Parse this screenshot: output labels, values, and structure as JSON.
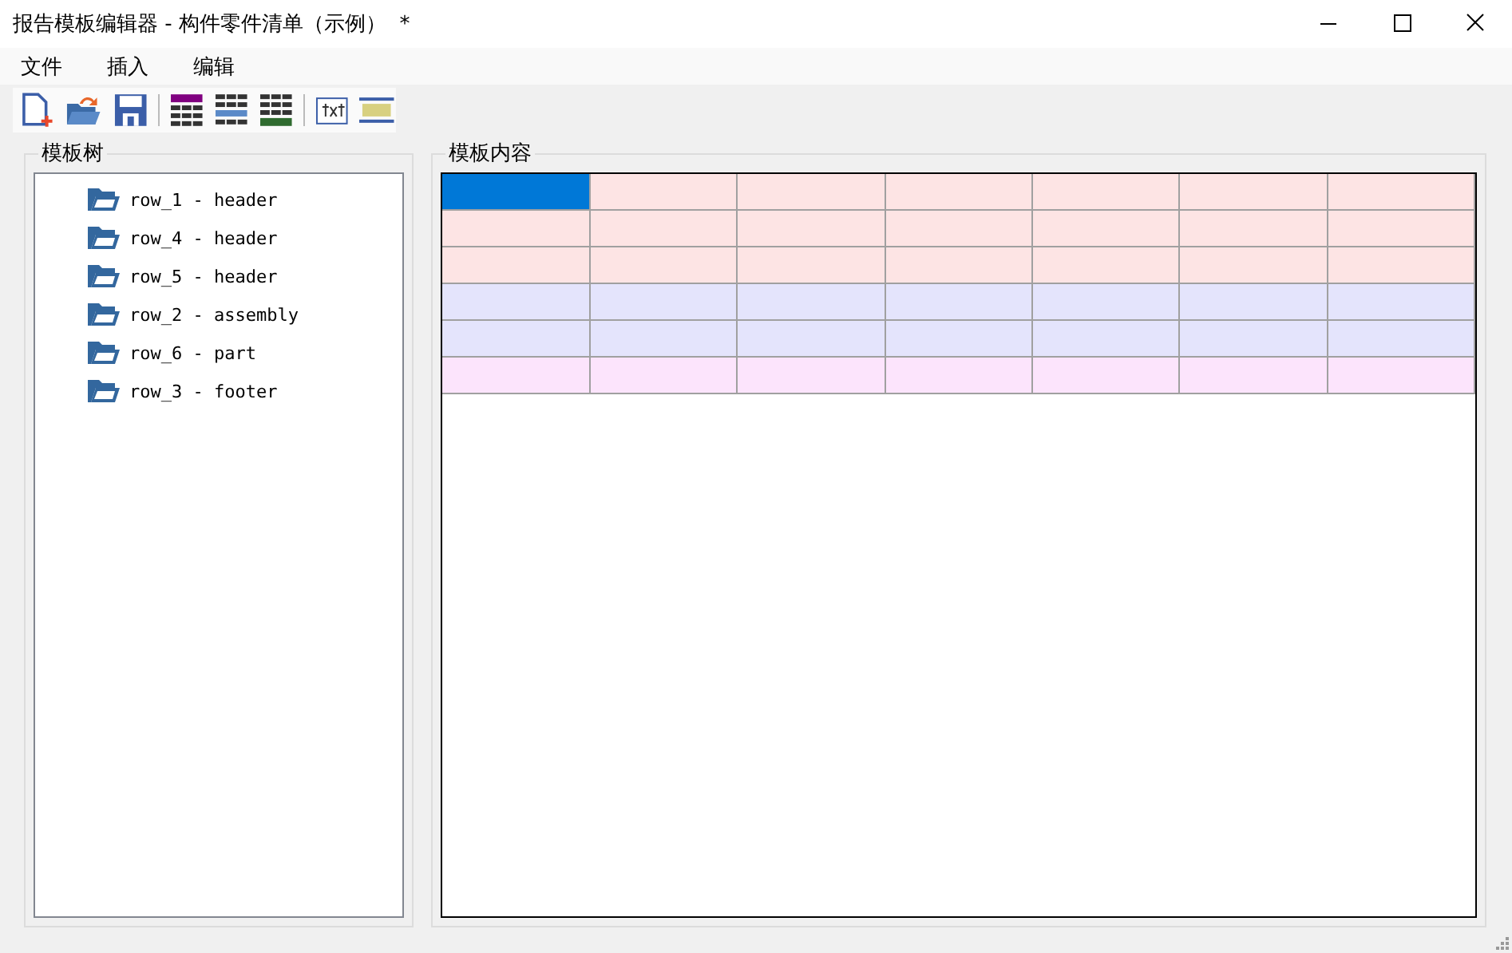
{
  "window": {
    "title": "报告模板编辑器 - 构件零件清单（示例）  *"
  },
  "menu": [
    "文件",
    "插入",
    "编辑"
  ],
  "tree_panel": {
    "title": "模板树",
    "items": [
      {
        "label": "row_1 - header"
      },
      {
        "label": "row_4 - header"
      },
      {
        "label": "row_5 - header"
      },
      {
        "label": "row_2 - assembly"
      },
      {
        "label": "row_6 - part"
      },
      {
        "label": "row_3 - footer"
      }
    ]
  },
  "content_panel": {
    "title": "模板内容",
    "rows": [
      {
        "color": "#fde4e4",
        "cells": [
          {
            "selected": true
          },
          {
            "selected": false
          },
          {
            "selected": false
          },
          {
            "selected": false
          },
          {
            "selected": false
          },
          {
            "selected": false
          },
          {
            "selected": false
          }
        ]
      },
      {
        "color": "#fde4e4",
        "cells": [
          {
            "selected": false
          },
          {
            "selected": false
          },
          {
            "selected": false
          },
          {
            "selected": false
          },
          {
            "selected": false
          },
          {
            "selected": false
          },
          {
            "selected": false
          }
        ]
      },
      {
        "color": "#fde4e4",
        "cells": [
          {
            "selected": false
          },
          {
            "selected": false
          },
          {
            "selected": false
          },
          {
            "selected": false
          },
          {
            "selected": false
          },
          {
            "selected": false
          },
          {
            "selected": false
          }
        ]
      },
      {
        "color": "#e4e4fc",
        "cells": [
          {
            "selected": false
          },
          {
            "selected": false
          },
          {
            "selected": false
          },
          {
            "selected": false
          },
          {
            "selected": false
          },
          {
            "selected": false
          },
          {
            "selected": false
          }
        ]
      },
      {
        "color": "#e4e4fc",
        "cells": [
          {
            "selected": false
          },
          {
            "selected": false
          },
          {
            "selected": false
          },
          {
            "selected": false
          },
          {
            "selected": false
          },
          {
            "selected": false
          },
          {
            "selected": false
          }
        ]
      },
      {
        "color": "#fce4fc",
        "cells": [
          {
            "selected": false
          },
          {
            "selected": false
          },
          {
            "selected": false
          },
          {
            "selected": false
          },
          {
            "selected": false
          },
          {
            "selected": false
          },
          {
            "selected": false
          }
        ]
      }
    ]
  }
}
